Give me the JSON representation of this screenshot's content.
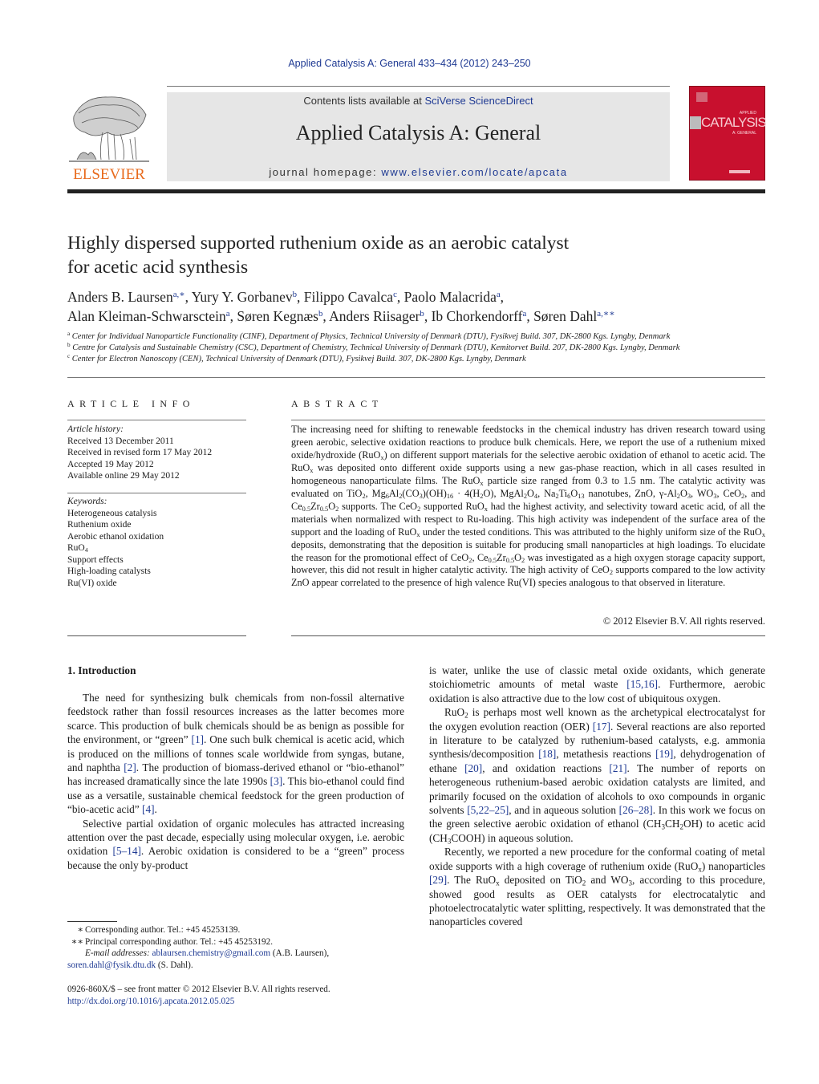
{
  "header": {
    "journal_reference": "Applied Catalysis A: General 433–434 (2012) 243–250",
    "contents_prefix": "Contents lists available at ",
    "contents_link": "SciVerse ScienceDirect",
    "journal_title": "Applied Catalysis A: General",
    "homepage_prefix": "journal homepage: ",
    "homepage_link": "www.elsevier.com/locate/apcata",
    "publisher_logo_text": "ELSEVIER",
    "cover": {
      "top_word": "APPLIED",
      "title_word": "CATALYSIS",
      "sub_word": "A: GENERAL",
      "color": "#c8102e"
    }
  },
  "article": {
    "title_lines": [
      "Highly dispersed supported ruthenium oxide as an aerobic catalyst",
      "for acetic acid synthesis"
    ],
    "authors": [
      {
        "name": "Anders B. Laursen",
        "mark": "a,∗",
        "sep": ", "
      },
      {
        "name": "Yury Y. Gorbanev",
        "mark": "b",
        "sep": ", "
      },
      {
        "name": "Filippo Cavalca",
        "mark": "c",
        "sep": ", "
      },
      {
        "name": "Paolo Malacrida",
        "mark": "a",
        "sep": ",",
        "break": true
      },
      {
        "name": "Alan Kleiman-Schwarsctein",
        "mark": "a",
        "sep": ", "
      },
      {
        "name": "Søren Kegnæs",
        "mark": "b",
        "sep": ", "
      },
      {
        "name": "Anders Riisager",
        "mark": "b",
        "sep": ", "
      },
      {
        "name": "Ib Chorkendorff",
        "mark": "a",
        "sep": ", "
      },
      {
        "name": "Søren Dahl",
        "mark": "a,∗∗",
        "sep": ""
      }
    ],
    "affiliations": [
      {
        "mark": "a",
        "text": "Center for Individual Nanoparticle Functionality (CINF), Department of Physics, Technical University of Denmark (DTU), Fysikvej Build. 307, DK-2800 Kgs. Lyngby, Denmark"
      },
      {
        "mark": "b",
        "text": "Centre for Catalysis and Sustainable Chemistry (CSC), Department of Chemistry, Technical University of Denmark (DTU), Kemitorvet Build. 207, DK-2800 Kgs. Lyngby, Denmark"
      },
      {
        "mark": "c",
        "text": "Center for Electron Nanoscopy (CEN), Technical University of Denmark (DTU), Fysikvej Build. 307, DK-2800 Kgs. Lyngby, Denmark"
      }
    ]
  },
  "article_info": {
    "heading": "ARTICLE INFO",
    "history_label": "Article history:",
    "history": [
      "Received 13 December 2011",
      "Received in revised form 17 May 2012",
      "Accepted 19 May 2012",
      "Available online 29 May 2012"
    ],
    "keywords_label": "Keywords:",
    "keywords": [
      "Heterogeneous catalysis",
      "Ruthenium oxide",
      "Aerobic ethanol oxidation",
      "RuO_{4}",
      "Support effects",
      "High-loading catalysts",
      "Ru(VI) oxide"
    ]
  },
  "abstract": {
    "heading": "ABSTRACT",
    "text": "The increasing need for shifting to renewable feedstocks in the chemical industry has driven research toward using green aerobic, selective oxidation reactions to produce bulk chemicals. Here, we report the use of a ruthenium mixed oxide/hydroxide (RuO_{x}) on different support materials for the selective aerobic oxidation of ethanol to acetic acid. The RuO_{x} was deposited onto different oxide supports using a new gas-phase reaction, which in all cases resulted in homogeneous nanoparticulate films. The RuO_{x} particle size ranged from 0.3 to 1.5 nm. The catalytic activity was evaluated on TiO_{2}, Mg_{6}Al_{2}(CO_{3})(OH)_{16} · 4(H_{2}O), MgAl_{2}O_{4}, Na_{2}Ti_{6}O_{13} nanotubes, ZnO, γ-Al_{2}O_{3}, WO_{3}, CeO_{2}, and Ce_{0.5}Zr_{0.5}O_{2} supports. The CeO_{2} supported RuO_{x} had the highest activity, and selectivity toward acetic acid, of all the materials when normalized with respect to Ru-loading. This high activity was independent of the surface area of the support and the loading of RuO_{x} under the tested conditions. This was attributed to the highly uniform size of the RuO_{x} deposits, demonstrating that the deposition is suitable for producing small nanoparticles at high loadings. To elucidate the reason for the promotional effect of CeO_{2}, Ce_{0.5}Zr_{0.5}O_{2} was investigated as a high oxygen storage capacity support, however, this did not result in higher catalytic activity. The high activity of CeO_{2} supports compared to the low activity ZnO appear correlated to the presence of high valence Ru(VI) species analogous to that observed in literature.",
    "copyright": "© 2012 Elsevier B.V. All rights reserved."
  },
  "body": {
    "section_heading": "1.  Introduction",
    "left_paragraphs": [
      {
        "indent": true,
        "text": "The need for synthesizing bulk chemicals from non-fossil alternative feedstock rather than fossil resources increases as the latter becomes more scarce. This production of bulk chemicals should be as benign as possible for the environment, or “green” [[1]]. One such bulk chemical is acetic acid, which is produced on the millions of tonnes scale worldwide from syngas, butane, and naphtha [[2]]. The production of biomass-derived ethanol or “bio-ethanol” has increased dramatically since the late 1990s [[3]]. This bio-ethanol could find use as a versatile, sustainable chemical feedstock for the green production of “bio-acetic acid” [[4]]."
      },
      {
        "indent": true,
        "text": "Selective partial oxidation of organic molecules has attracted increasing attention over the past decade, especially using molecular oxygen, i.e. aerobic oxidation [[5–14]]. Aerobic oxidation is considered to be a “green” process because the only by-product"
      }
    ],
    "right_paragraphs": [
      {
        "indent": false,
        "text": "is water, unlike the use of classic metal oxide oxidants, which generate stoichiometric amounts of metal waste [[15,16]]. Furthermore, aerobic oxidation is also attractive due to the low cost of ubiquitous oxygen."
      },
      {
        "indent": true,
        "text": "RuO_{2} is perhaps most well known as the archetypical electrocatalyst for the oxygen evolution reaction (OER) [[17]]. Several reactions are also reported in literature to be catalyzed by ruthenium-based catalysts, e.g. ammonia synthesis/decomposition [[18]], metathesis reactions [[19]], dehydrogenation of ethane [[20]], and oxidation reactions [[21]]. The number of reports on heterogeneous ruthenium-based aerobic oxidation catalysts are limited, and primarily focused on the oxidation of alcohols to oxo compounds in organic solvents [[5,22–25]], and in aqueous solution [[26–28]]. In this work we focus on the green selective aerobic oxidation of ethanol (CH_{3}CH_{2}OH) to acetic acid (CH_{3}COOH) in aqueous solution."
      },
      {
        "indent": true,
        "text": "Recently, we reported a new procedure for the conformal coating of metal oxide supports with a high coverage of ruthenium oxide (RuO_{x}) nanoparticles [[29]]. The RuO_{x} deposited on TiO_{2} and WO_{3}, according to this procedure, showed good results as OER catalysts for electrocatalytic and photoelectrocatalytic water splitting, respectively. It was demonstrated that the nanoparticles covered"
      }
    ]
  },
  "footnotes": {
    "items": [
      {
        "mark": "∗",
        "text": "Corresponding author. Tel.: +45 45253139."
      },
      {
        "mark": "∗∗",
        "text": "Principal corresponding author. Tel.: +45 45253192."
      }
    ],
    "email_label": "E-mail addresses:",
    "emails": [
      {
        "address": "ablaursen.chemistry@gmail.com",
        "owner": " (A.B. Laursen),"
      },
      {
        "address": "soren.dahl@fysik.dtu.dk",
        "owner": " (S. Dahl)."
      }
    ],
    "front_matter": "0926-860X/$ – see front matter © 2012 Elsevier B.V. All rights reserved.",
    "doi": "http://dx.doi.org/10.1016/j.apcata.2012.05.025"
  },
  "colors": {
    "link": "#1f3a93",
    "elsevier_orange": "#e86a1c",
    "masthead_bg": "#e6e6e6",
    "cover_red": "#c8102e"
  }
}
